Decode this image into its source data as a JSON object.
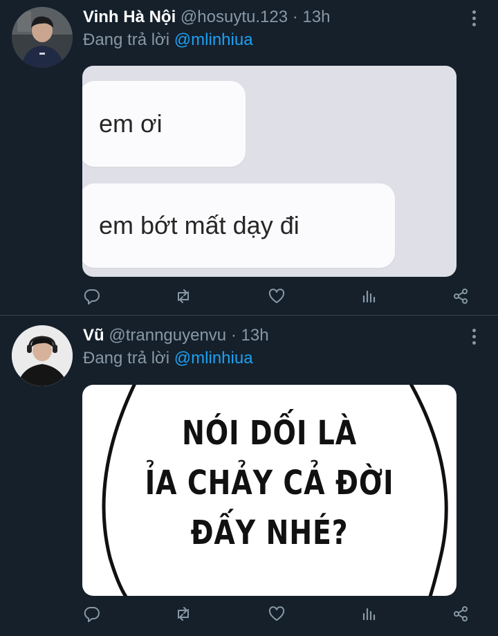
{
  "tweets": [
    {
      "name": "Vinh Hà Nội",
      "handle": "@hosuytu.123",
      "separator": "·",
      "time": "13h",
      "reply_prefix": "Đang trả lời",
      "reply_to": "@mlinhiua",
      "media": {
        "type": "chat-bubbles",
        "bubbles": [
          "em ơi",
          "em bớt mất dạy đi"
        ]
      }
    },
    {
      "name": "Vũ",
      "handle": "@trannguyenvu",
      "separator": "·",
      "time": "13h",
      "reply_prefix": "Đang trả lời",
      "reply_to": "@mlinhiua",
      "media": {
        "type": "comic-speech",
        "lines": [
          "NÓI DỐI LÀ",
          "ỈA CHẢY CẢ ĐỜI",
          "ĐẤY NHÉ?"
        ]
      }
    }
  ],
  "icons": {
    "reply": "reply-icon",
    "retweet": "retweet-icon",
    "like": "heart-icon",
    "analytics": "analytics-icon",
    "share": "share-icon",
    "more": "more-vertical-icon"
  },
  "colors": {
    "background": "#15202b",
    "secondary_text": "#8899a6",
    "link": "#1da1f2",
    "divider": "#38444d"
  }
}
